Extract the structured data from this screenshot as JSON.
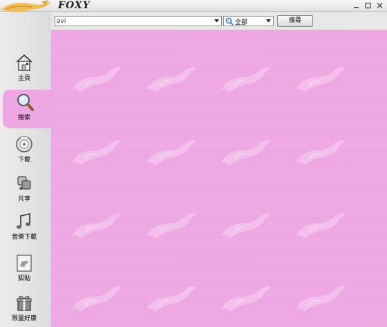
{
  "app": {
    "brand": "FOXY",
    "window_controls": [
      "minimize",
      "maximize",
      "close"
    ]
  },
  "toolbar": {
    "search_value": "avi",
    "category_value": "全部",
    "search_button_label": "搜尋"
  },
  "sidebar": {
    "items": [
      {
        "label": "主頁",
        "icon": "home-icon"
      },
      {
        "label": "搜索",
        "icon": "magnifier-icon",
        "active": true
      },
      {
        "label": "下載",
        "icon": "download-icon"
      },
      {
        "label": "共享",
        "icon": "share-icon"
      },
      {
        "label": "音樂下載",
        "icon": "music-note-icon"
      },
      {
        "label": "狐貼",
        "icon": "fox-note-icon"
      },
      {
        "label": "限量好康",
        "icon": "gift-icon"
      }
    ]
  },
  "colors": {
    "content_background": "#eda7e3",
    "watermark": "#f3c3ec",
    "sidebar": "#e2e2e2"
  }
}
